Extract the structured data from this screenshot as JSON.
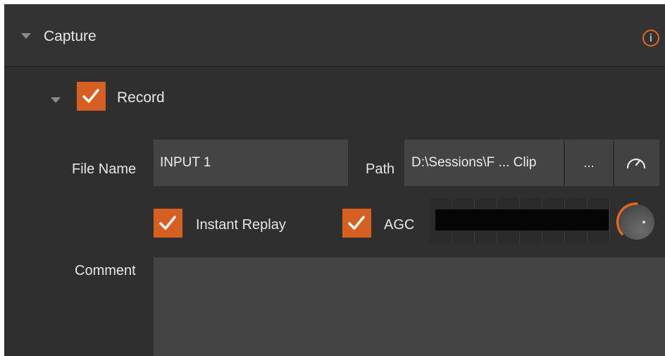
{
  "section": {
    "title": "Capture"
  },
  "record": {
    "label": "Record",
    "checked": true
  },
  "file_name": {
    "label": "File Name",
    "value": "INPUT 1"
  },
  "path": {
    "label": "Path",
    "value": "D:\\Sessions\\F ... Clip",
    "browse_label": "..."
  },
  "instant_replay": {
    "label": "Instant Replay",
    "checked": true
  },
  "agc": {
    "label": "AGC",
    "checked": true
  },
  "comment": {
    "label": "Comment",
    "value": ""
  },
  "icons": {
    "expand": "triangle-down-icon",
    "info": "info-icon",
    "check": "checkmark-icon",
    "speed": "gauge-icon",
    "volume_knob": "knob-icon"
  },
  "colors": {
    "accent": "#d65f22",
    "panel_bg": "#2f2f2f",
    "field_bg": "#444444"
  }
}
